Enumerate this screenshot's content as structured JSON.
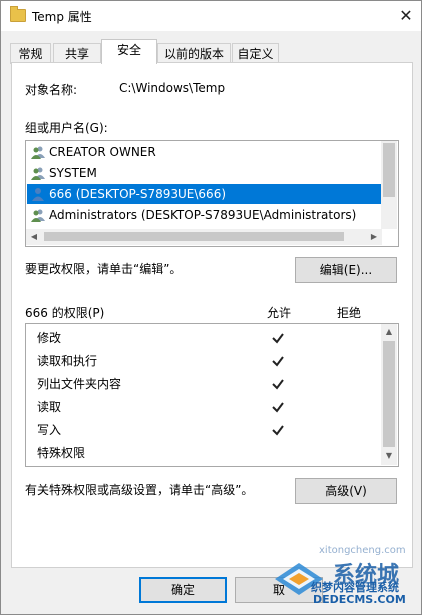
{
  "window": {
    "title": "Temp 属性",
    "close_glyph": "✕"
  },
  "tabs": [
    {
      "label": "常规"
    },
    {
      "label": "共享"
    },
    {
      "label": "安全"
    },
    {
      "label": "以前的版本"
    },
    {
      "label": "自定义"
    }
  ],
  "security": {
    "object_name_label": "对象名称:",
    "object_name_value": "C:\\Windows\\Temp",
    "users_label": "组或用户名(G):",
    "users": [
      {
        "name": "CREATOR OWNER",
        "icon": "user-group-icon"
      },
      {
        "name": "SYSTEM",
        "icon": "user-group-icon"
      },
      {
        "name": "666 (DESKTOP-S7893UE\\666)",
        "icon": "user-icon",
        "selected": true
      },
      {
        "name": "Administrators (DESKTOP-S7893UE\\Administrators)",
        "icon": "user-group-icon"
      }
    ],
    "edit_hint": "要更改权限，请单击“编辑”。",
    "edit_button": "编辑(E)...",
    "perm_header": "666 的权限(P)",
    "allow_header": "允许",
    "deny_header": "拒绝",
    "permissions": [
      {
        "name": "修改",
        "allow": true,
        "deny": false
      },
      {
        "name": "读取和执行",
        "allow": true,
        "deny": false
      },
      {
        "name": "列出文件夹内容",
        "allow": true,
        "deny": false
      },
      {
        "name": "读取",
        "allow": true,
        "deny": false
      },
      {
        "name": "写入",
        "allow": true,
        "deny": false
      },
      {
        "name": "特殊权限",
        "allow": false,
        "deny": false
      }
    ],
    "advanced_hint": "有关特殊权限或高级设置，请单击“高级”。",
    "advanced_button": "高级(V)"
  },
  "footer": {
    "ok_button": "确定",
    "cancel_button": "取"
  },
  "watermark": {
    "brand": "系统城",
    "line1": "织梦内容管理系统",
    "line2": "DEDECMS.COM",
    "url": "xitongcheng.com"
  },
  "colors": {
    "selection": "#0078d7",
    "window_bg": "#f0f0f0",
    "panel_bg": "#ffffff"
  }
}
